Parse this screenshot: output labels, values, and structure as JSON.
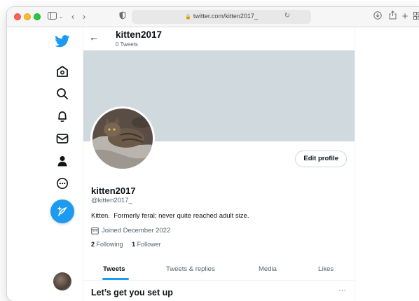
{
  "browser": {
    "url": "twitter.com/kitten2017_"
  },
  "header": {
    "display_name": "kitten2017",
    "tweet_count": "0 Tweets"
  },
  "profile": {
    "edit_button": "Edit profile",
    "display_name": "kitten2017",
    "handle": "@kitten2017_",
    "bio": "Kitten.  Formerly feral; never quite reached adult size.",
    "joined": "Joined December 2022",
    "following_count": "2",
    "following_label": "Following",
    "followers_count": "1",
    "followers_label": "Follower"
  },
  "tabs": [
    {
      "label": "Tweets",
      "active": true
    },
    {
      "label": "Tweets & replies",
      "active": false
    },
    {
      "label": "Media",
      "active": false
    },
    {
      "label": "Likes",
      "active": false
    }
  ],
  "setup": {
    "title": "Let’s get you set up",
    "more": "···"
  },
  "sidebar_icons": [
    "twitter-logo-icon",
    "home-icon",
    "search-icon",
    "notifications-bell-icon",
    "messages-envelope-icon",
    "profile-person-icon",
    "more-circle-icon",
    "compose-tweet-icon"
  ],
  "colors": {
    "accent": "#1d9bf0",
    "banner": "#cfd9de",
    "secondary_text": "#536471"
  }
}
